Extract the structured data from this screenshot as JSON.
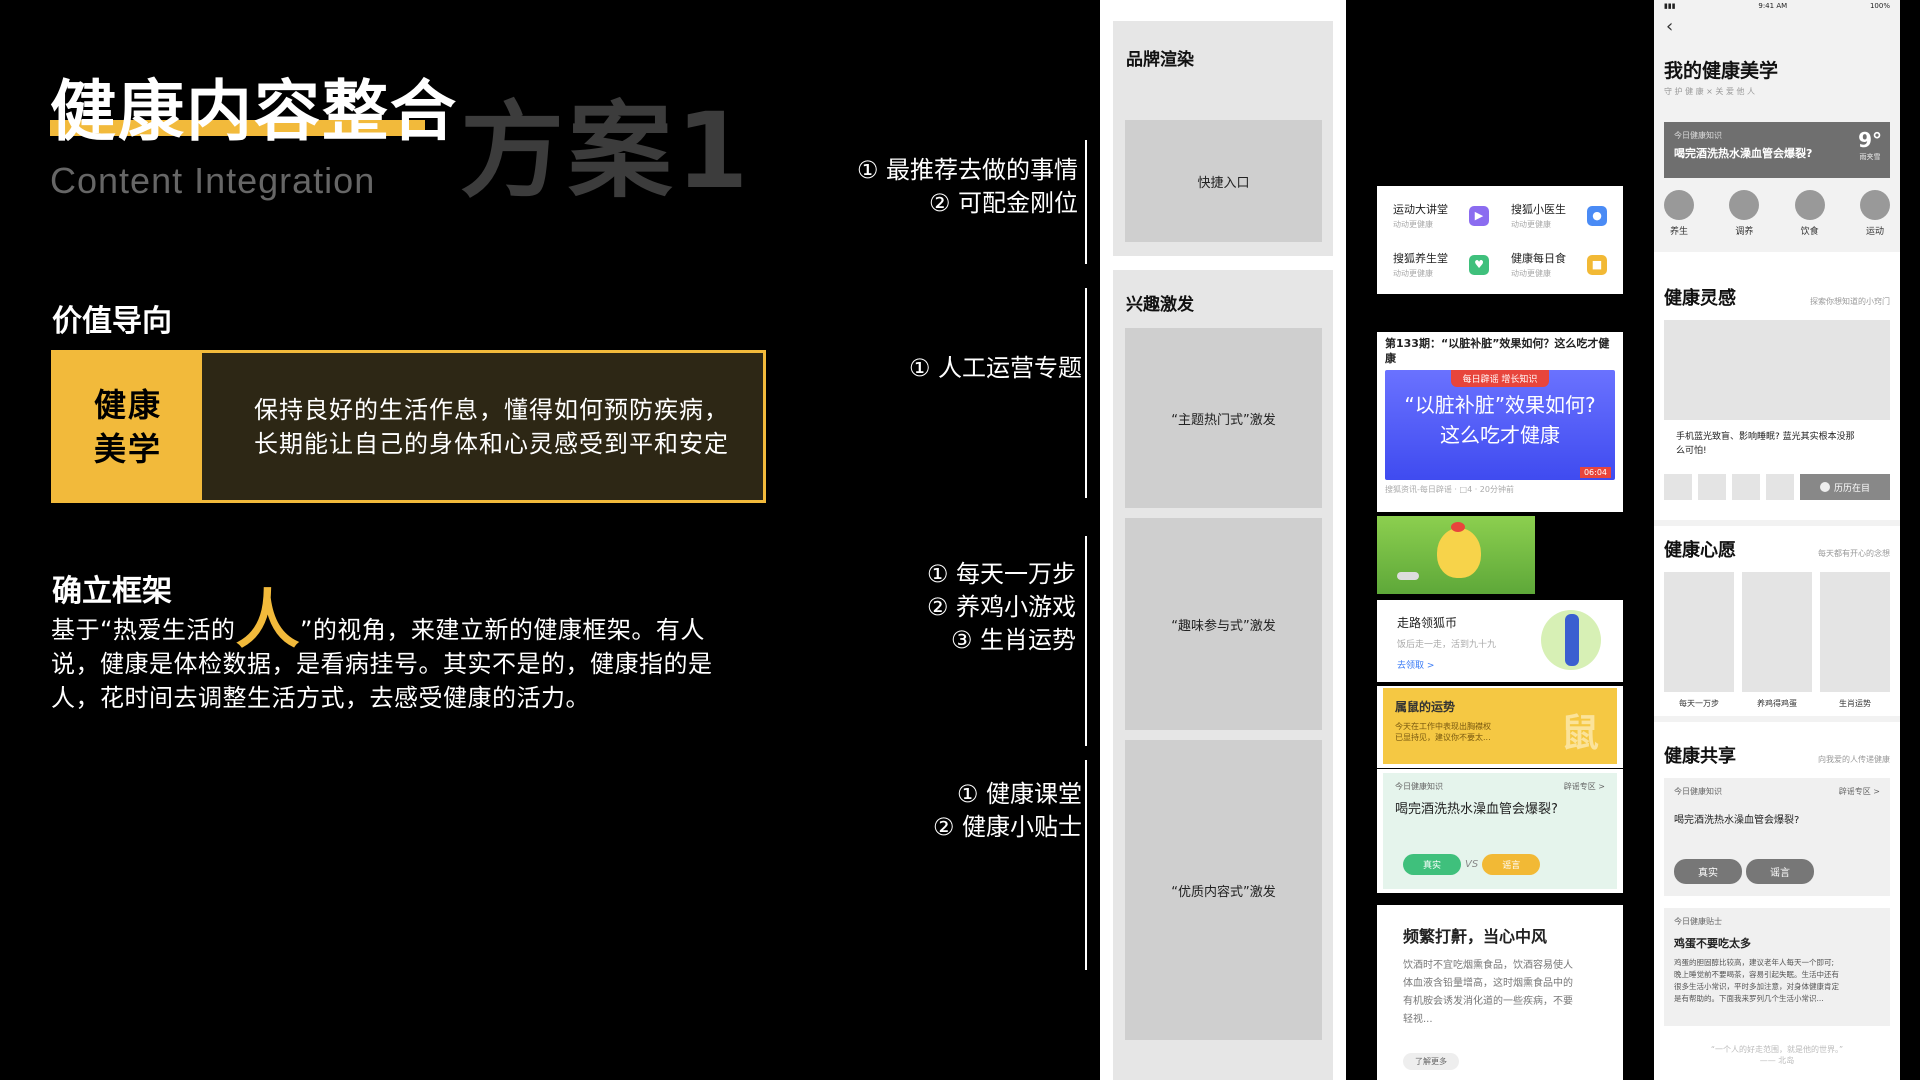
{
  "slide": {
    "title": "健康内容整合",
    "subtitle": "Content Integration",
    "scheme": "方案1",
    "value_section": {
      "heading": "价值导向",
      "label_line1": "健康",
      "label_line2": "美学",
      "desc_line1": "保持良好的生活作息，懂得如何预防疾病，",
      "desc_line2": "长期能让自己的身体和心灵感受到平和安定"
    },
    "frame_section": {
      "heading": "确立框架",
      "text_pre": "基于“热爱生活的",
      "big_char": "人",
      "text_post": "”的视角，来建立新的健康框架。有人",
      "line2": "说，健康是体检数据，是看病挂号。其实不是的，健康指的是",
      "line3": "人，花时间去调整生活方式，去感受健康的活力。"
    }
  },
  "annotations": [
    [
      "① 最推荐去做的事情",
      "② 可配金刚位"
    ],
    [
      "① 人工运营专题"
    ],
    [
      "① 每天一万步",
      "② 养鸡小游戏",
      "③ 生肖运势"
    ],
    [
      "① 健康课堂",
      "② 健康小贴士"
    ]
  ],
  "wireframe": {
    "sec1_title": "品牌渲染",
    "sec1_block": "快捷入口",
    "sec2_title": "兴趣激发",
    "block1": "“主题热门式”激发",
    "block2": "“趣味参与式”激发",
    "block3": "“优质内容式”激发"
  },
  "screens": {
    "tiles": [
      {
        "title": "运动大讲堂",
        "sub": "动动更健康",
        "icon": "▶",
        "color": "#8b6cf0"
      },
      {
        "title": "搜狐小医生",
        "sub": "动动更健康",
        "icon": "●",
        "color": "#4a8bf5"
      },
      {
        "title": "搜狐养生堂",
        "sub": "动动更健康",
        "icon": "♥",
        "color": "#3fc07c"
      },
      {
        "title": "健康每日食",
        "sub": "动动更健康",
        "icon": "■",
        "color": "#f2b935"
      }
    ],
    "topic": {
      "header": "第133期：“以脏补脏”效果如何？这么吃才健康",
      "tag": "每日辟谣 增长知识",
      "banner_line1": "“以脏补脏”效果如何?",
      "banner_line2": "这么吃才健康",
      "footer": "搜狐资讯-每日辟谣 · □4 · 20分钟前",
      "time": "06:04"
    },
    "walk": {
      "title": "走路领狐币",
      "sub": "饭后走一走，活到九十九",
      "link": "去领取 >"
    },
    "luck": {
      "title": "属鼠的运势",
      "sub1": "今天在工作中表现出胸襟权",
      "sub2": "已显持见，建议你不要太...",
      "char": "鼠"
    },
    "quiz": {
      "label": "今日健康知识",
      "zone": "辟谣专区 >",
      "question": "喝完酒洗热水澡血管会爆裂?",
      "btn_true": "真实",
      "vs": "VS",
      "btn_false": "谣言"
    },
    "article": {
      "title": "频繁打鼾，当心中风",
      "line1": "饮酒时不宜吃烟熏食品，饮酒容易使人",
      "line2": "体血液含铅量增高，这时烟熏食品中的",
      "line3": "有机胺会诱发消化道的一些疾病，不要",
      "line4": "轻视...",
      "button": "了解更多"
    }
  },
  "phone": {
    "status_time": "9:41 AM",
    "status_battery": "100%",
    "title": "我的健康美学",
    "subtitle": "守 护 健 康  ×  关 爱 他 人",
    "card_label": "今日健康知识",
    "card_text": "喝完酒洗热水澡血管会爆裂?",
    "weather_temp": "9°",
    "weather_desc": "雨夹雪",
    "categories": [
      "养生",
      "调养",
      "饮食",
      "运动"
    ],
    "inspire_title": "健康灵感",
    "inspire_hint": "探索你想知道的小窍门",
    "inspire_text1": "手机蓝光致盲、影响睡眠? 蓝光其实根本没那",
    "inspire_text2": "么可怕!",
    "history_btn": "历历在目",
    "wish_title": "健康心愿",
    "wish_hint": "每天都有开心的念想",
    "wish_items": [
      "每天一万步",
      "养鸡得鸡蛋",
      "生肖运势"
    ],
    "share_title": "健康共享",
    "share_hint": "向我爱的人传递健康",
    "share_label": "今日健康知识",
    "share_zone": "辟谣专区 >",
    "share_q": "喝完酒洗热水澡血管会爆裂?",
    "share_true": "真实",
    "share_false": "谣言",
    "tip_label": "今日健康贴士",
    "tip_title": "鸡蛋不要吃太多",
    "tip_line1": "鸡蛋的胆固醇比较高，建议老年人每天一个即可;",
    "tip_line2": "晚上睡觉前不要喝茶，容易引起失眠。生活中还有",
    "tip_line3": "很多生活小常识，平时多加注意，对身体健康肯定",
    "tip_line4": "是有帮助的。下面我来罗列几个生活小常识...",
    "quote1": "“一个人的好走范围，就是他的世界。”",
    "quote2": "—— 北岛"
  }
}
